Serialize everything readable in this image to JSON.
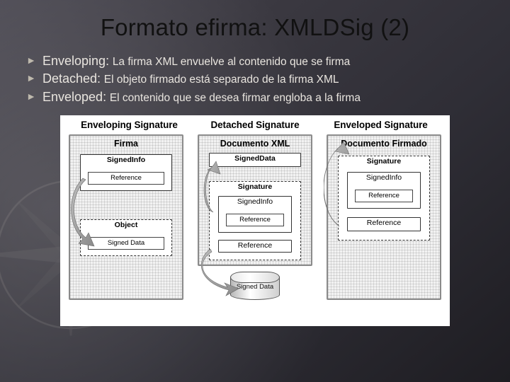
{
  "title": "Formato efirma: XMLDSig (2)",
  "bullets": [
    {
      "term": "Enveloping:",
      "desc": "La firma XML envuelve al contenido que se firma"
    },
    {
      "term": "Detached:",
      "desc": "El objeto firmado está separado de la firma XML"
    },
    {
      "term": "Enveloped:",
      "desc": "El contenido que se desea firmar engloba a la firma"
    }
  ],
  "diagram": {
    "headers": [
      "Enveloping Signature",
      "Detached Signature",
      "Enveloped Signature"
    ],
    "col1": {
      "outer": "Firma",
      "signedinfo": "SignedInfo",
      "ref": "Reference",
      "object": "Object",
      "signedData": "Signed Data"
    },
    "col2": {
      "outer": "Documento XML",
      "signedData": "SignedData",
      "sig": "Signature",
      "si": "SignedInfo",
      "ref": "Reference",
      "db": "Signed Data"
    },
    "col3": {
      "outer": "Documento Firmado",
      "sig": "Signature",
      "si": "SignedInfo",
      "ref": "Reference"
    }
  }
}
